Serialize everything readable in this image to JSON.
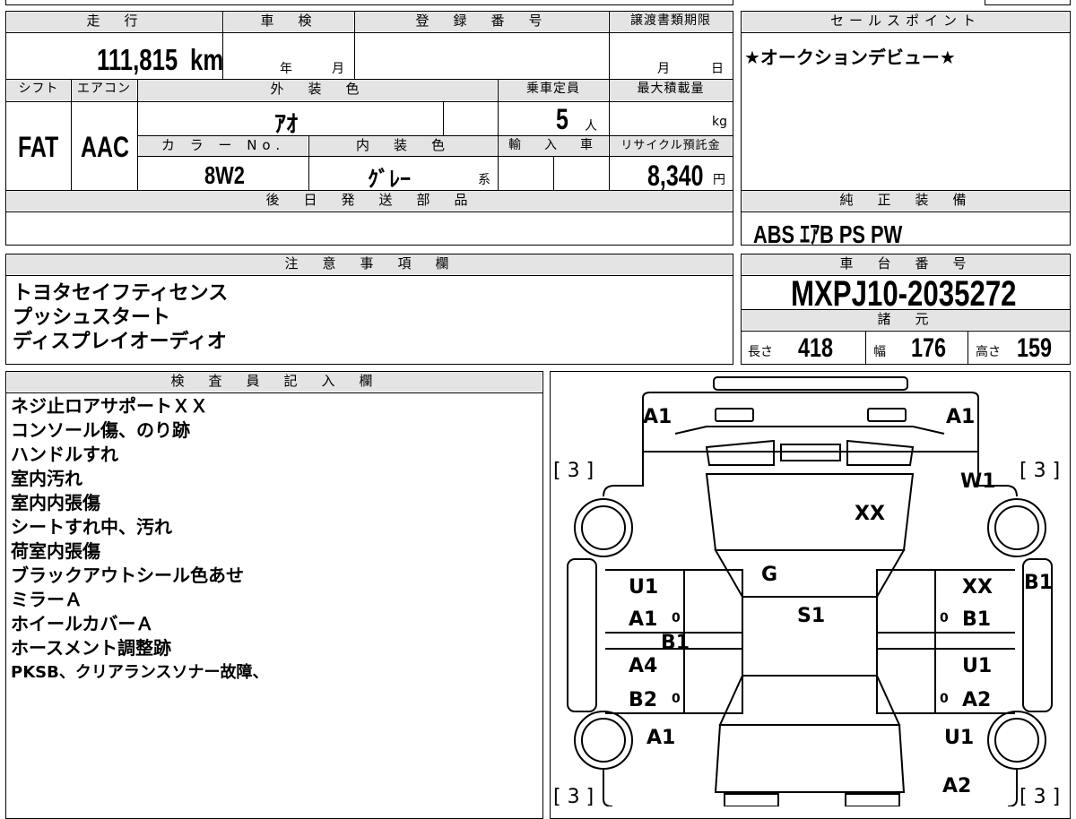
{
  "headers": {
    "mileage": "走　行",
    "inspection": "車　検",
    "registration": "登　録　番　号",
    "transfer_deadline": "譲渡書類期限",
    "sales_point": "セールスポイント",
    "shift": "シフト",
    "aircon": "エアコン",
    "exterior_color": "外　装　色",
    "capacity": "乗車定員",
    "max_load": "最大積載量",
    "color_no": "カ ラ ー No.",
    "interior_color": "内　装　色",
    "import": "輸　入　車",
    "recycle_fee": "リサイクル預託金",
    "later_parts": "後　日　発　送　部　品",
    "genuine_equipment": "純　正　装　備",
    "notes": "注　意　事　項　欄",
    "chassis_no": "車　台　番　号",
    "specs": "諸　元",
    "inspector": "検　査　員　記　入　欄"
  },
  "mileage": {
    "value": "111,815",
    "unit": "km"
  },
  "inspection": {
    "year": "年",
    "month": "月"
  },
  "transfer_deadline": {
    "month": "月",
    "day": "日"
  },
  "sales_point": "★オークションデビュー★",
  "shift": "FAT",
  "aircon": "AAC",
  "exterior_color": "ｱｵ",
  "capacity": {
    "value": "5",
    "unit": "人"
  },
  "max_load_unit": "kg",
  "color_no": "8W2",
  "interior_color": {
    "value": "ｸﾞﾚｰ",
    "suffix": "系"
  },
  "recycle_fee": {
    "value": "8,340",
    "unit": "円"
  },
  "genuine_equipment": "ABS ｴｱB PS PW",
  "notes": [
    "トヨタセイフティセンス",
    "プッシュスタート",
    "ディスプレイオーディオ"
  ],
  "chassis_no": "MXPJ10-2035272",
  "specs": {
    "length_label": "長さ",
    "length": "418",
    "width_label": "幅",
    "width": "176",
    "height_label": "高さ",
    "height": "159"
  },
  "inspector_notes": [
    "ネジ止ロアサポートＸＸ",
    "コンソール傷、のり跡",
    "ハンドルすれ",
    "室内汚れ",
    "室内内張傷",
    "シートすれ中、汚れ",
    "荷室内張傷",
    "ブラックアウトシール色あせ",
    "ミラーＡ",
    "ホイールカバーＡ",
    "ホースメント調整跡",
    "PKSB、クリアランスソナー故障、"
  ],
  "damage_map": {
    "front_left": "A1",
    "front_right": "A1",
    "bracket_fl": "[ 3 ]",
    "bracket_fr": "[ 3 ]",
    "bracket_rl": "[ 3 ]",
    "bracket_rr": "[ 3 ]",
    "fender_right": "W1",
    "hood": "XX",
    "windshield": "G",
    "roof": "S1",
    "left_front_door_1": "U1",
    "left_front_door_2": "A1",
    "left_sill": "B1",
    "left_rear_door_1": "A4",
    "left_rear_door_2": "B2",
    "rear_left": "A1",
    "right_front_door_1": "XX",
    "right_front_door_2": "B1",
    "right_mirror": "B1",
    "right_rear_door_1": "U1",
    "right_rear_door_2": "A2",
    "rear_right_1": "U1",
    "rear_right_2": "A2",
    "zero_marks": [
      "0",
      "0",
      "0",
      "0"
    ]
  }
}
